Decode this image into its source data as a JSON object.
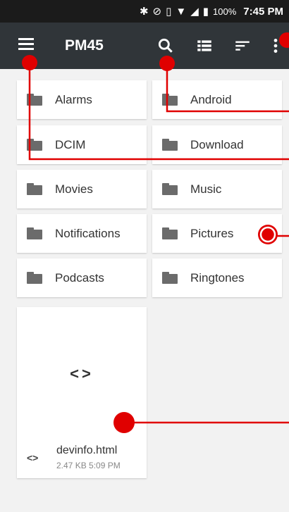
{
  "status": {
    "battery": "100%",
    "time": "7:45 PM"
  },
  "appbar": {
    "title": "PM45",
    "menu_icon": "hamburger-menu-icon",
    "actions": [
      "search-icon",
      "list-view-icon",
      "sort-icon",
      "more-vert-icon"
    ]
  },
  "folders": [
    {
      "label": "Alarms"
    },
    {
      "label": "Android"
    },
    {
      "label": "DCIM"
    },
    {
      "label": "Download"
    },
    {
      "label": "Movies"
    },
    {
      "label": "Music"
    },
    {
      "label": "Notifications"
    },
    {
      "label": "Pictures"
    },
    {
      "label": "Podcasts"
    },
    {
      "label": "Ringtones"
    }
  ],
  "file": {
    "preview_glyph": "<>",
    "type_glyph": "<>",
    "name": "devinfo.html",
    "meta": "2.47 KB 5:09 PM"
  },
  "colors": {
    "annotation": "#e00000",
    "appbar": "#303539",
    "statusbar": "#1b1b1b"
  }
}
